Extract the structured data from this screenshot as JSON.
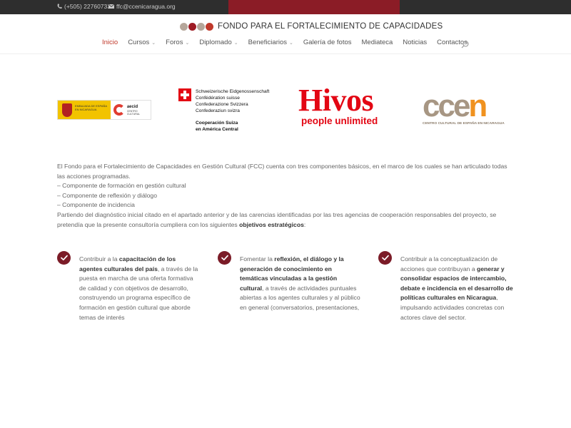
{
  "topbar": {
    "phone": "(+505) 22760733",
    "email": "ffc@ccenicaragua.org"
  },
  "header": {
    "site_title": "FONDO PARA EL FORTALECIMIENTO DE CAPACIDADES",
    "logo_colors": [
      "#b5a69a",
      "#9e1b24",
      "#b5a69a",
      "#c0392b"
    ]
  },
  "nav": {
    "items": [
      {
        "label": "Inicio",
        "active": true,
        "dropdown": false
      },
      {
        "label": "Cursos",
        "active": false,
        "dropdown": true
      },
      {
        "label": "Foros",
        "active": false,
        "dropdown": true
      },
      {
        "label": "Diplomado",
        "active": false,
        "dropdown": true
      },
      {
        "label": "Beneficiarios",
        "active": false,
        "dropdown": true
      },
      {
        "label": "Galería de fotos",
        "active": false,
        "dropdown": false
      },
      {
        "label": "Mediateca",
        "active": false,
        "dropdown": false
      },
      {
        "label": "Noticias",
        "active": false,
        "dropdown": false
      },
      {
        "label": "Contactos",
        "active": false,
        "dropdown": false
      }
    ],
    "dropdown_chevron": "⌄",
    "active_color": "#c0392b"
  },
  "logos": {
    "spain": {
      "ministry_text": "EMBAJADA DE ESPAÑA EN NICARAGUA",
      "aecid": "aecid",
      "aecid_sub": "CENTRO CULTURAL"
    },
    "swiss": {
      "lines": [
        "Schweizerische Eidgenossenschaft",
        "Confédération suisse",
        "Confederazione Svizzera",
        "Confederaziun svizra"
      ],
      "coop_lines": [
        "Cooperación Suiza",
        "en América Central"
      ]
    },
    "hivos": {
      "word": "Hivos",
      "tagline": "people unlimited"
    },
    "ccen": {
      "word_main": "cce",
      "word_accent": "n",
      "tagline": "CENTRO CULTURAL DE ESPAÑA EN NICARAGUA"
    }
  },
  "intro": {
    "paragraph": "El Fondo para el Fortalecimiento de Capacidades en Gestión Cultural (FCC) cuenta con tres componentes básicos, en el marco de los cuales se han articulado todas las acciones programadas.",
    "components": [
      "– Componente de formación en gestión cultural",
      "– Componente de reflexión y diálogo",
      "– Componente de incidencia"
    ],
    "closing_before": "Partiendo del diagnóstico inicial citado en el apartado anterior y de las carencias identificadas por las tres agencias de cooperación responsables del proyecto, se pretendía que la presente consultoría cumpliera con los siguientes ",
    "closing_bold": "objetivos estratégicos",
    "closing_after": ":"
  },
  "objectives": [
    {
      "before": "Contribuir a la ",
      "bold": "capacitación de los agentes culturales del país",
      "after": ", a través de la puesta en marcha de una oferta formativa de calidad y con objetivos de desarrollo, construyendo un programa específico de formación en gestión cultural que aborde temas de interés"
    },
    {
      "before": "Fomentar la ",
      "bold": "reflexión, el diálogo y la generación de conocimiento en temáticas vinculadas a la gestión cultural",
      "after": ", a través de actividades puntuales abiertas a los agentes culturales y al público en general (conversatorios, presentaciones,"
    },
    {
      "before": "Contribuir a la conceptualización de acciones que contribuyan a ",
      "bold": "generar y consolidar espacios de intercambio, debate e incidencia en el desarrollo de políticas culturales en Nicaragua",
      "after": ", impulsando actividades concretas con actores clave del sector."
    }
  ],
  "colors": {
    "topbar_bg": "#2e2e2e",
    "topbar_accent": "#8b1c26",
    "check_bg": "#7b1b27",
    "hivos_red": "#e30613",
    "ccen_taupe": "#a79683",
    "ccen_orange": "#f0921f"
  }
}
